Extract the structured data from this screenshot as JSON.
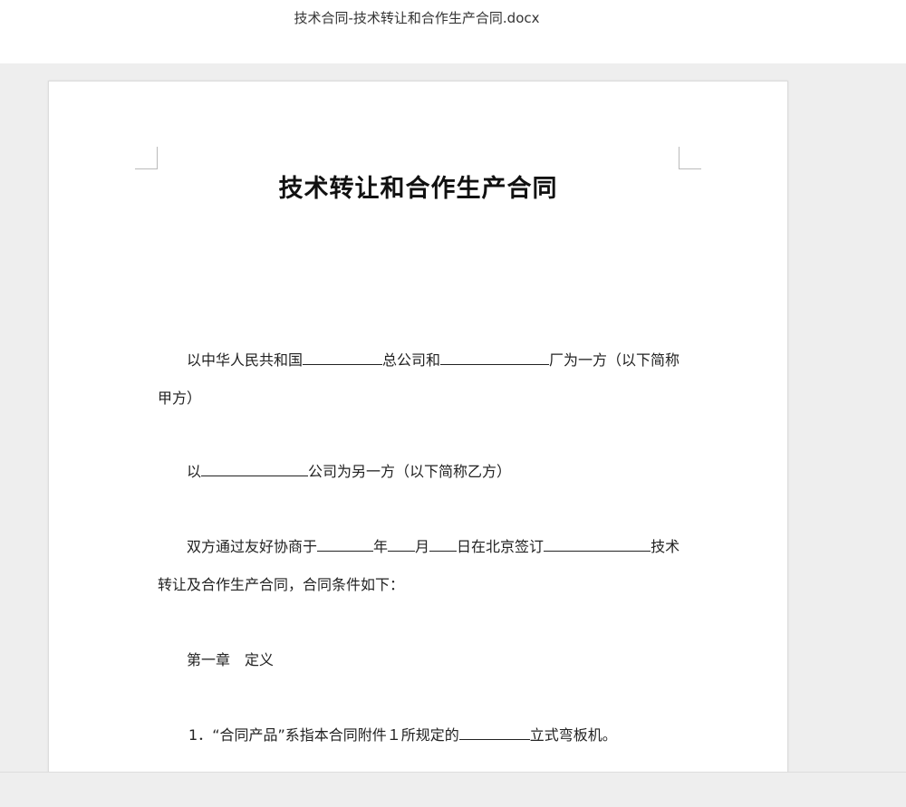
{
  "window": {
    "filename": "技术合同-技术转让和合作生产合同.docx"
  },
  "document": {
    "heading": "技术转让和合作生产合同",
    "p1_a": "以中华人民共和国",
    "p1_b": "总公司和",
    "p1_c": "厂为一方（以下简称甲方）",
    "p2_a": "以",
    "p2_b": "公司为另一方（以下简称乙方）",
    "p3_a": "双方通过友好协商于",
    "p3_b": "年",
    "p3_c": "月",
    "p3_d": "日在北京签订",
    "p3_e": "技术转让及合作生产合同，合同条件如下：",
    "chapter": "第一章　定义",
    "item1_num": "1．",
    "item1_a": "“合同产品”系指本合同附件１所规定的",
    "item1_b": "立式弯板机。"
  }
}
